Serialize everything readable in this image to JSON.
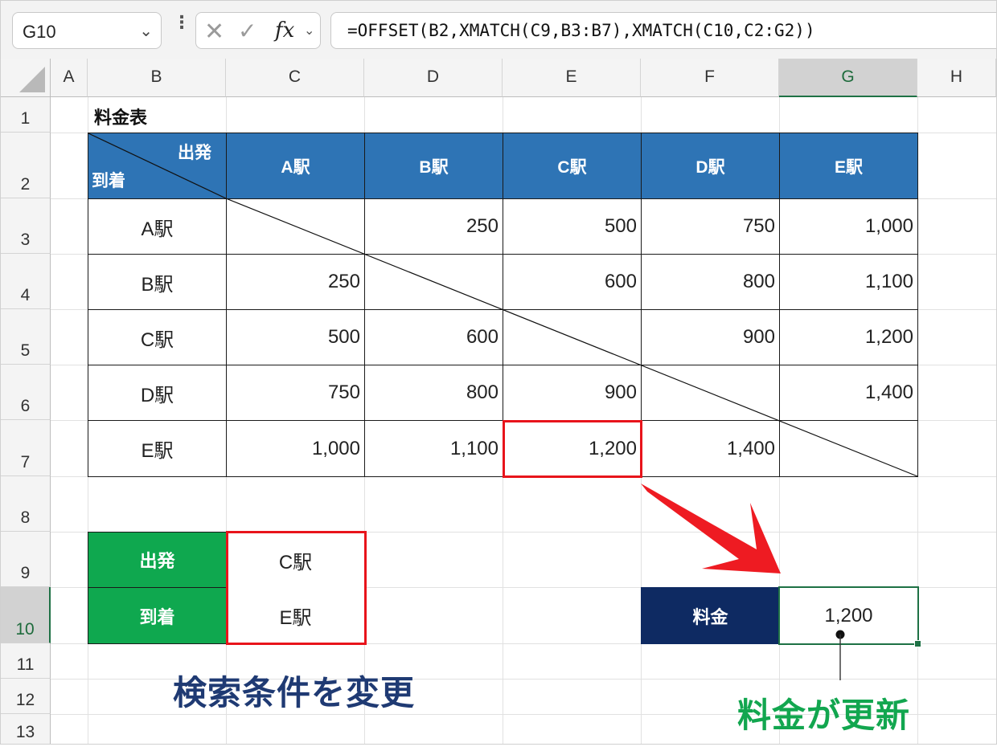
{
  "formula_bar": {
    "name_box": "G10",
    "formula": "=OFFSET(B2,XMATCH(C9,B3:B7),XMATCH(C10,C2:G2))"
  },
  "columns": [
    "A",
    "B",
    "C",
    "D",
    "E",
    "F",
    "G",
    "H"
  ],
  "selected_column": "G",
  "rows": [
    "1",
    "2",
    "3",
    "4",
    "5",
    "6",
    "7",
    "8",
    "9",
    "10",
    "11",
    "12",
    "13"
  ],
  "selected_row": "10",
  "sheet": {
    "title": "料金表",
    "corner_header": {
      "departure": "出発",
      "arrival": "到着"
    },
    "column_stations": [
      "A駅",
      "B駅",
      "C駅",
      "D駅",
      "E駅"
    ],
    "row_stations": [
      "A駅",
      "B駅",
      "C駅",
      "D駅",
      "E駅"
    ],
    "matrix": [
      [
        "",
        "250",
        "500",
        "750",
        "1,000"
      ],
      [
        "250",
        "",
        "600",
        "800",
        "1,100"
      ],
      [
        "500",
        "600",
        "",
        "900",
        "1,200"
      ],
      [
        "750",
        "800",
        "900",
        "",
        "1,400"
      ],
      [
        "1,000",
        "1,100",
        "1,200",
        "1,400",
        ""
      ]
    ],
    "search": {
      "departure_label": "出発",
      "departure_value": "C駅",
      "arrival_label": "到着",
      "arrival_value": "E駅"
    },
    "fare": {
      "label": "料金",
      "value": "1,200"
    }
  },
  "annotations": {
    "change_condition": "検索条件を変更",
    "fare_updated": "料金が更新"
  },
  "colors": {
    "table_header": "#2e74b5",
    "search_label": "#0fa84f",
    "fare_label": "#0e2a62",
    "highlight": "#e8141b",
    "annotation_blue": "#1f3a73",
    "annotation_green": "#12a64f",
    "excel_select": "#1e7145"
  }
}
